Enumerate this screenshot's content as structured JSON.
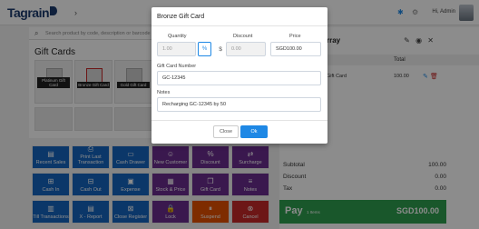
{
  "app": {
    "logo": "Tagrain",
    "user": "Hi, Admin"
  },
  "search": {
    "placeholder": "Search product by code, description or barcode"
  },
  "products": {
    "title": "Gift Cards",
    "tiles": [
      "Platinum Gift Card",
      "Bronze Gift Card",
      "Gold Gift Card"
    ]
  },
  "actions": [
    {
      "label": "Recent Sales",
      "icon": "recent-sales-icon",
      "glyph": "▤",
      "color": "blue"
    },
    {
      "label": "Print Last Transaction",
      "icon": "print-icon",
      "glyph": "⎙",
      "color": "blue"
    },
    {
      "label": "Cash Drawer",
      "icon": "cash-drawer-icon",
      "glyph": "▭",
      "color": "blue"
    },
    {
      "label": "New Customer",
      "icon": "new-customer-icon",
      "glyph": "☺",
      "color": "purple"
    },
    {
      "label": "Discount",
      "icon": "discount-icon",
      "glyph": "%",
      "color": "purple"
    },
    {
      "label": "Surcharge",
      "icon": "surcharge-icon",
      "glyph": "⇄",
      "color": "purple"
    },
    {
      "label": "Cash In",
      "icon": "cash-in-icon",
      "glyph": "⊞",
      "color": "blue"
    },
    {
      "label": "Cash Out",
      "icon": "cash-out-icon",
      "glyph": "⊟",
      "color": "blue"
    },
    {
      "label": "Expense",
      "icon": "expense-icon",
      "glyph": "▣",
      "color": "blue"
    },
    {
      "label": "Stock & Price",
      "icon": "stock-price-icon",
      "glyph": "▦",
      "color": "purple"
    },
    {
      "label": "Gift Card",
      "icon": "gift-card-icon",
      "glyph": "❒",
      "color": "purple"
    },
    {
      "label": "Notes",
      "icon": "notes-icon",
      "glyph": "≡",
      "color": "purple"
    },
    {
      "label": "Till Transactions",
      "icon": "till-icon",
      "glyph": "▥",
      "color": "blue"
    },
    {
      "label": "X - Report",
      "icon": "x-report-icon",
      "glyph": "▤",
      "color": "blue"
    },
    {
      "label": "Close Register",
      "icon": "close-register-icon",
      "glyph": "⊠",
      "color": "blue"
    },
    {
      "label": "Lock",
      "icon": "lock-icon",
      "glyph": "🔒",
      "color": "purple"
    },
    {
      "label": "Suspend",
      "icon": "suspend-icon",
      "glyph": "⏸",
      "color": "orange"
    },
    {
      "label": "Cancel",
      "icon": "cancel-icon",
      "glyph": "⊗",
      "color": "red"
    }
  ],
  "cart": {
    "title": "rray",
    "columns": {
      "product": "ct",
      "total": "Total"
    },
    "item": {
      "name": "Gift Card",
      "total": "100.00"
    },
    "subtotal_label": "Subtotal",
    "subtotal": "100.00",
    "discount_label": "Discount",
    "discount": "0.00",
    "tax_label": "Tax",
    "tax": "0.00",
    "pay_label": "Pay",
    "pay_items": "1 Items",
    "pay_total": "SGD100.00"
  },
  "modal": {
    "title": "Bronze Gift Card",
    "quantity_label": "Quantity",
    "quantity": "1.00",
    "discount_label": "Discount",
    "discount_percent_btn": "%",
    "discount_dollar_btn": "$",
    "discount_value": "0.00",
    "price_label": "Price",
    "price": "SGD100.00",
    "card_number_label": "Gift Card Number",
    "card_number": "GC-12345",
    "notes_label": "Notes",
    "notes": "Recharging GC-12345 by 50",
    "close_label": "Close",
    "ok_label": "Ok"
  },
  "colors": {
    "blue": "#1565c0",
    "purple": "#6a2c8f",
    "red": "#c62828",
    "orange": "#e65100",
    "pay": "#2e9e4f",
    "accent": "#1e88e5"
  }
}
